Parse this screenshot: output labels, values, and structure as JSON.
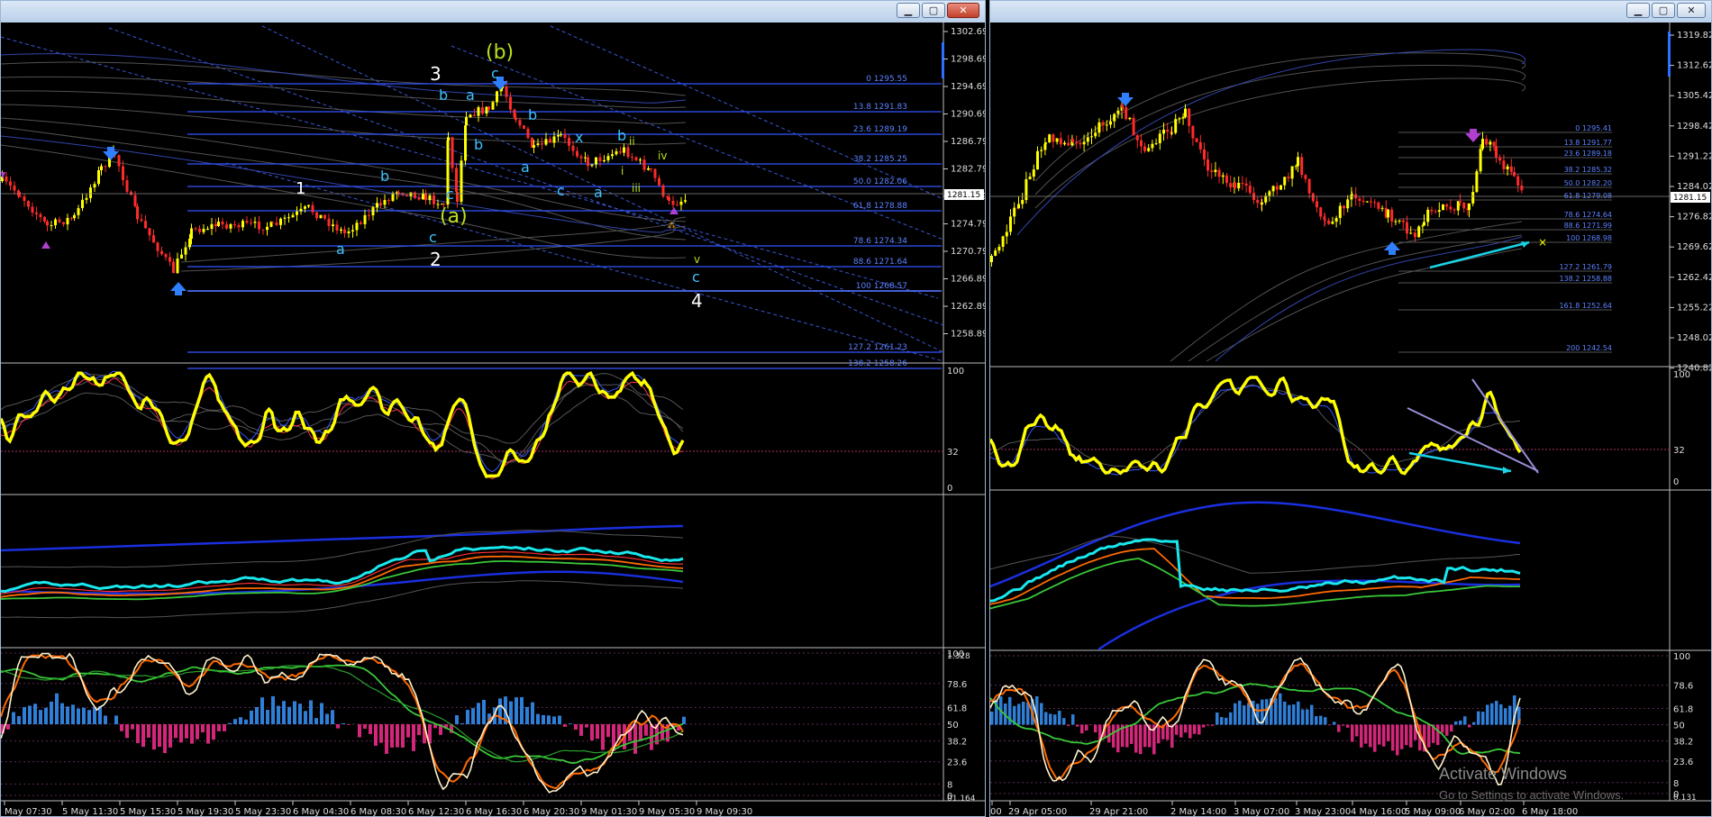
{
  "window_buttons": {
    "minimize": "▁",
    "maximize": "▢",
    "close": "✕"
  },
  "colors": {
    "yellow": "#ffff00",
    "cyan": "#00ffff",
    "blue_label": "#3fa3ff",
    "fib_line": "#3355ff",
    "magenta": "#e0307a",
    "hist_blue": "#2f7fd8",
    "orange": "#ff6a00",
    "green": "#39c739"
  },
  "left": {
    "price_axis": [
      "1302.69",
      "1298.69",
      "1294.69",
      "1290.69",
      "1286.79",
      "1282.79",
      "1278.79",
      "1274.79",
      "1270.79",
      "1266.89",
      "1262.89",
      "1258.89"
    ],
    "current_price": "1281.15",
    "fib_levels": [
      "0 1295.55",
      "13.8 1291.83",
      "23.6 1289.19",
      "38.2 1285.25",
      "50.0 1282.06",
      "61.8 1278.88",
      "78.6 1274.34",
      "88.6 1271.64",
      "100 1268.57",
      "127.2 1261.23",
      "138.2 1258.26"
    ],
    "wave_labels": {
      "w1": "1",
      "w2": "2",
      "w3": "3",
      "w4": "4",
      "wa_paren": "(a)",
      "wb_paren": "(b)",
      "small_a": "a",
      "small_b": "b",
      "small_c": "c",
      "small_x": "x",
      "roman_i": "i",
      "roman_ii": "ii",
      "roman_iii": "iii",
      "roman_iv": "iv",
      "roman_v": "v"
    },
    "rsi_levels": [
      "100",
      "32",
      "0"
    ],
    "osc_levels": [
      "100",
      "78.6",
      "61.8",
      "50",
      "38.2",
      "23.6",
      "8",
      "0"
    ],
    "osc_top": "1.328",
    "osc_bottom": "01.164",
    "time_axis": [
      "May 07:30",
      "5 May 11:30",
      "5 May 15:30",
      "5 May 19:30",
      "5 May 23:30",
      "6 May 04:30",
      "6 May 08:30",
      "6 May 12:30",
      "6 May 16:30",
      "6 May 20:30",
      "9 May 01:30",
      "9 May 05:30",
      "9 May 09:30"
    ]
  },
  "right": {
    "price_axis": [
      "1319.82",
      "1312.62",
      "1305.42",
      "1298.42",
      "1291.22",
      "1284.02",
      "1276.82",
      "1269.62",
      "1262.42",
      "1255.22",
      "1248.02",
      "1240.82"
    ],
    "current_price": "1281.15",
    "fib_levels": [
      "0 1295.41",
      "13.8 1291.77",
      "23.6 1289.18",
      "38.2 1285.32",
      "50.0 1282.20",
      "61.8 1279.08",
      "78.6 1274.64",
      "88.6 1271.99",
      "100 1268.98",
      "127.2 1261.79",
      "138.2 1258.88",
      "161.8 1252.64",
      "200 1242.54"
    ],
    "rsi_levels": [
      "100",
      "32",
      "0"
    ],
    "osc_levels": [
      "100",
      "78.6",
      "61.8",
      "50",
      "38.2",
      "23.6",
      "8",
      "0"
    ],
    "osc_bottom": "0.131",
    "time_axis": [
      "00",
      "29 Apr 05:00",
      "29 Apr 21:00",
      "2 May 14:00",
      "3 May 07:00",
      "3 May 23:00",
      "4 May 16:00",
      "5 May 09:00",
      "6 May 02:00",
      "6 May 18:00"
    ]
  },
  "watermark": {
    "title": "Activate Windows",
    "subtitle": "Go to Settings to activate Windows."
  }
}
